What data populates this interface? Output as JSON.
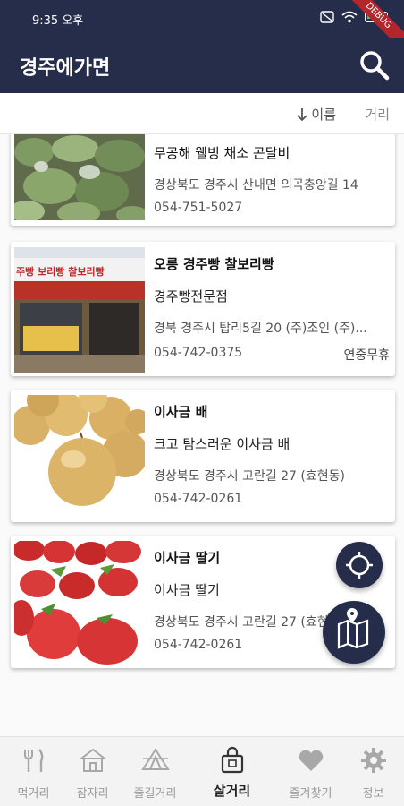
{
  "status_bar": {
    "time": "9:35 오후",
    "battery": "100",
    "debug_label": "DEBUG"
  },
  "app_bar": {
    "title": "경주에가면"
  },
  "sort": {
    "name_label": "이름",
    "distance_label": "거리"
  },
  "items": [
    {
      "title": "무공해 웰빙 채소 곤달비",
      "subtitle": "",
      "address": "경상북도 경주시 산내면 의곡충앙길 14",
      "phone": "054-751-5027",
      "extra": ""
    },
    {
      "title": "오릉 경주빵 찰보리빵",
      "subtitle": "경주빵전문점",
      "address": "경북 경주시 탑리5길 20 (주)조인 (주)...",
      "phone": "054-742-0375",
      "extra": "연중무휴"
    },
    {
      "title": "이사금 배",
      "subtitle": "크고 탐스러운 이사금 배",
      "address": "경상북도 경주시 고란길 27 (효현동)",
      "phone": "054-742-0261",
      "extra": ""
    },
    {
      "title": "이사금 딸기",
      "subtitle": "이사금 딸기",
      "address": "경상북도 경주시 고란길 27 (효현동)",
      "phone": "054-742-0261",
      "extra": ""
    }
  ],
  "bakery_sign": {
    "text": "주빵 보리빵 찰보리빵"
  },
  "nav": [
    {
      "label": "먹거리",
      "icon": "fork-knife-icon",
      "active": false
    },
    {
      "label": "잠자리",
      "icon": "house-icon",
      "active": false
    },
    {
      "label": "즐길거리",
      "icon": "tent-icon",
      "active": false
    },
    {
      "label": "살거리",
      "icon": "shopping-bag-icon",
      "active": true
    },
    {
      "label": "즐겨찾기",
      "icon": "heart-icon",
      "active": false
    },
    {
      "label": "정보",
      "icon": "gear-icon",
      "active": false
    }
  ],
  "colors": {
    "primary": "#262d4a",
    "nav_inactive": "#9a9a9a",
    "nav_active": "#222222"
  }
}
